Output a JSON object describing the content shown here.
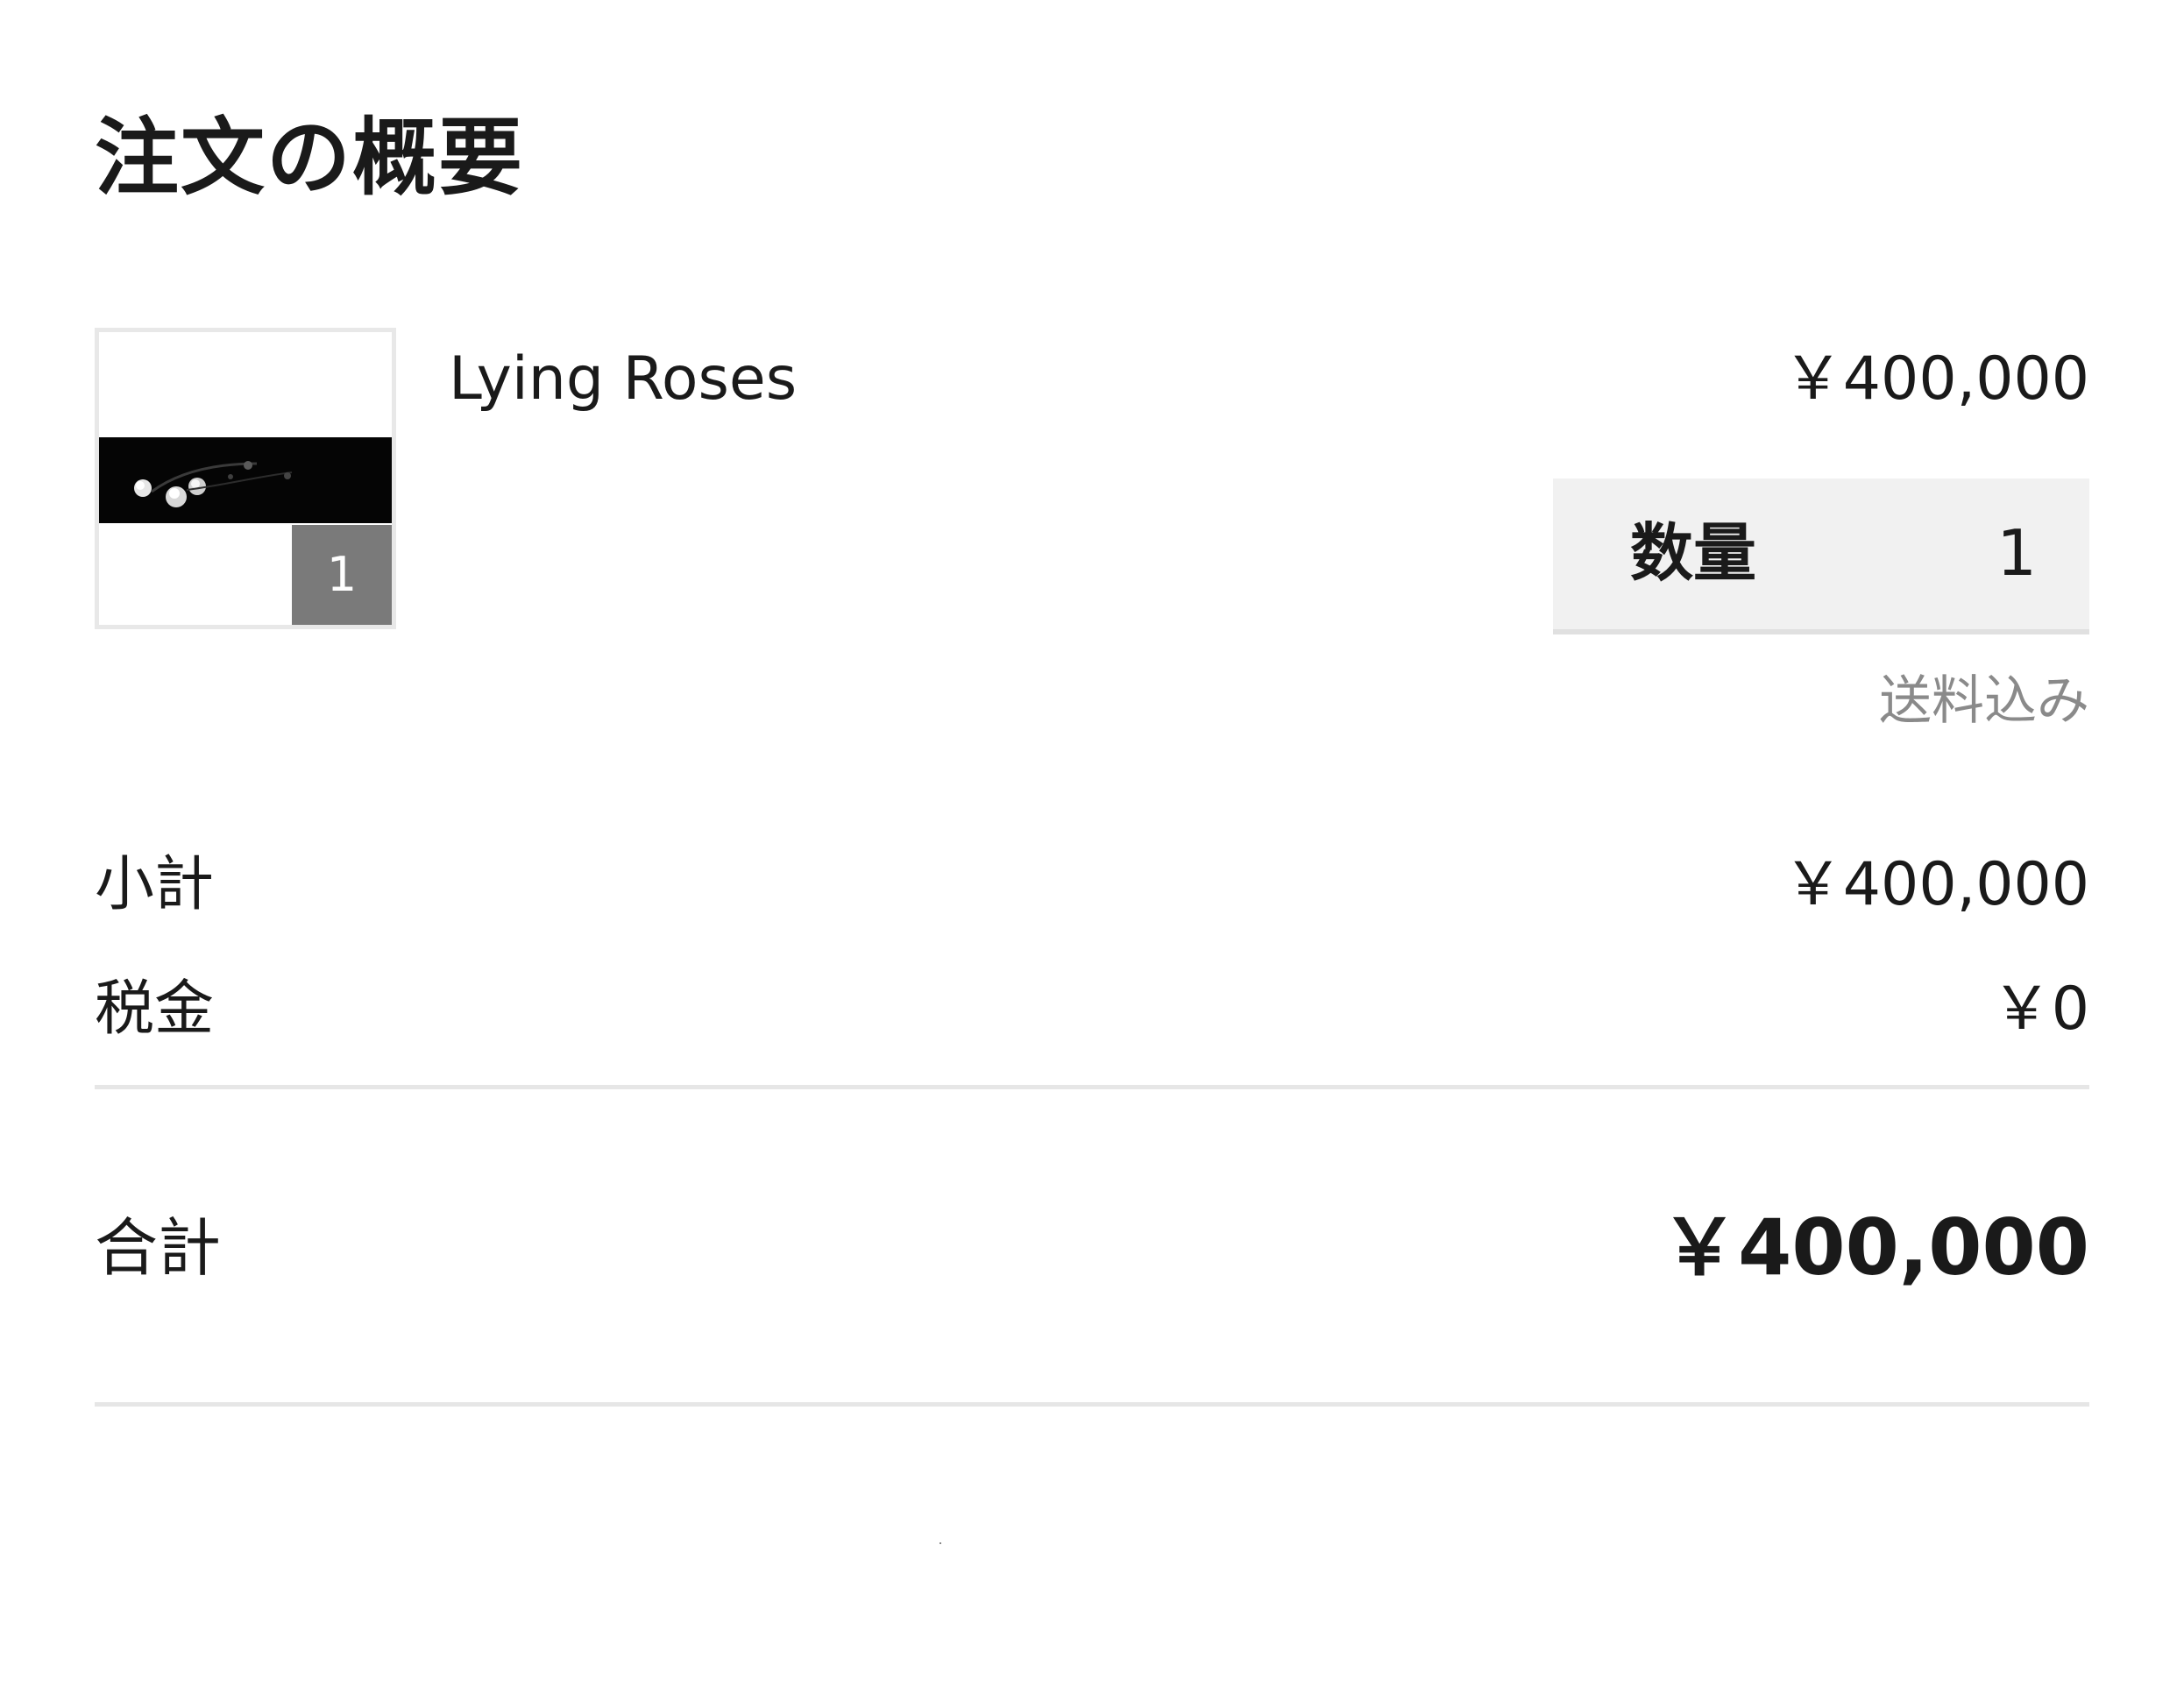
{
  "order_summary": {
    "title": "注文の概要",
    "item": {
      "name": "Lying Roses",
      "price": "￥400,000",
      "thumbnail_badge": "1",
      "quantity_label": "数量",
      "quantity_value": "1",
      "shipping_note": "送料込み"
    },
    "subtotal_label": "小計",
    "subtotal_value": "￥400,000",
    "tax_label": "税金",
    "tax_value": "￥0",
    "total_label": "合計",
    "total_value": "￥400,000"
  }
}
